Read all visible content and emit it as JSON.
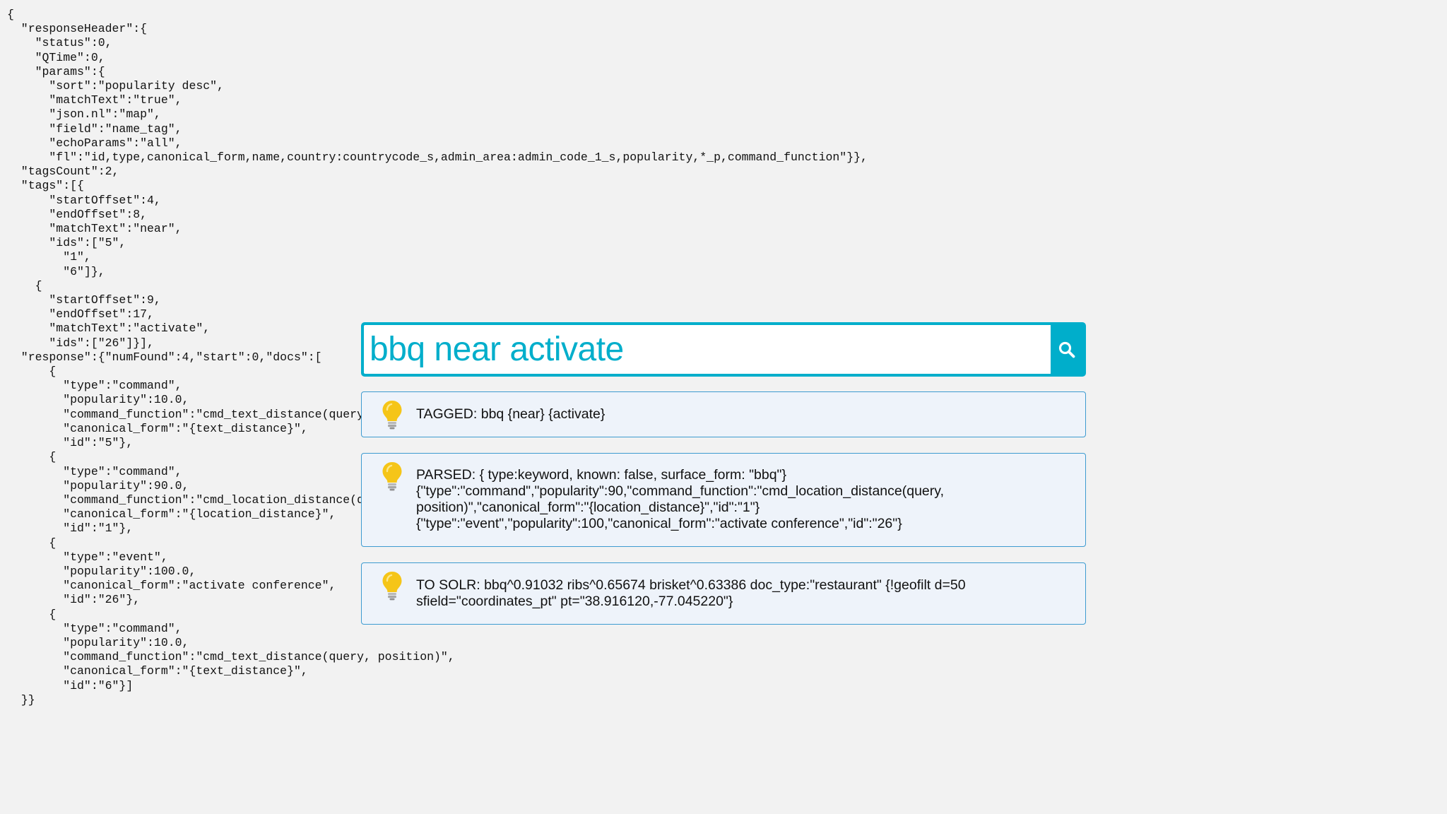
{
  "json_response": "{\n  \"responseHeader\":{\n    \"status\":0,\n    \"QTime\":0,\n    \"params\":{\n      \"sort\":\"popularity desc\",\n      \"matchText\":\"true\",\n      \"json.nl\":\"map\",\n      \"field\":\"name_tag\",\n      \"echoParams\":\"all\",\n      \"fl\":\"id,type,canonical_form,name,country:countrycode_s,admin_area:admin_code_1_s,popularity,*_p,command_function\"}},\n  \"tagsCount\":2,\n  \"tags\":[{\n      \"startOffset\":4,\n      \"endOffset\":8,\n      \"matchText\":\"near\",\n      \"ids\":[\"5\",\n        \"1\",\n        \"6\"]},\n    {\n      \"startOffset\":9,\n      \"endOffset\":17,\n      \"matchText\":\"activate\",\n      \"ids\":[\"26\"]}],\n  \"response\":{\"numFound\":4,\"start\":0,\"docs\":[\n      {\n        \"type\":\"command\",\n        \"popularity\":10.0,\n        \"command_function\":\"cmd_text_distance(query\n        \"canonical_form\":\"{text_distance}\",\n        \"id\":\"5\"},\n      {\n        \"type\":\"command\",\n        \"popularity\":90.0,\n        \"command_function\":\"cmd_location_distance(q\n        \"canonical_form\":\"{location_distance}\",\n        \"id\":\"1\"},\n      {\n        \"type\":\"event\",\n        \"popularity\":100.0,\n        \"canonical_form\":\"activate conference\",\n        \"id\":\"26\"},\n      {\n        \"type\":\"command\",\n        \"popularity\":10.0,\n        \"command_function\":\"cmd_text_distance(query, position)\",\n        \"canonical_form\":\"{text_distance}\",\n        \"id\":\"6\"}]\n  }}",
  "search": {
    "query": "bbq near activate",
    "button_icon": "search-icon",
    "accent_color": "#00aecb"
  },
  "results": {
    "icon": "lightbulb-icon",
    "icon_color": "#f5c518",
    "tagged": "TAGGED: bbq {near} {activate}",
    "parsed": "PARSED: { type:keyword, known: false, surface_form: \"bbq\"}\n{\"type\":\"command\",\"popularity\":90,\"command_function\":\"cmd_location_distance(query,\nposition)\",\"canonical_form\":\"{location_distance}\",\"id\":\"1\"}\n{\"type\":\"event\",\"popularity\":100,\"canonical_form\":\"activate conference\",\"id\":\"26\"}",
    "solr": "TO SOLR: bbq^0.91032 ribs^0.65674 brisket^0.63386 doc_type:\"restaurant\" {!geofilt d=50\nsfield=\"coordinates_pt\" pt=\"38.916120,-77.045220\"}"
  }
}
